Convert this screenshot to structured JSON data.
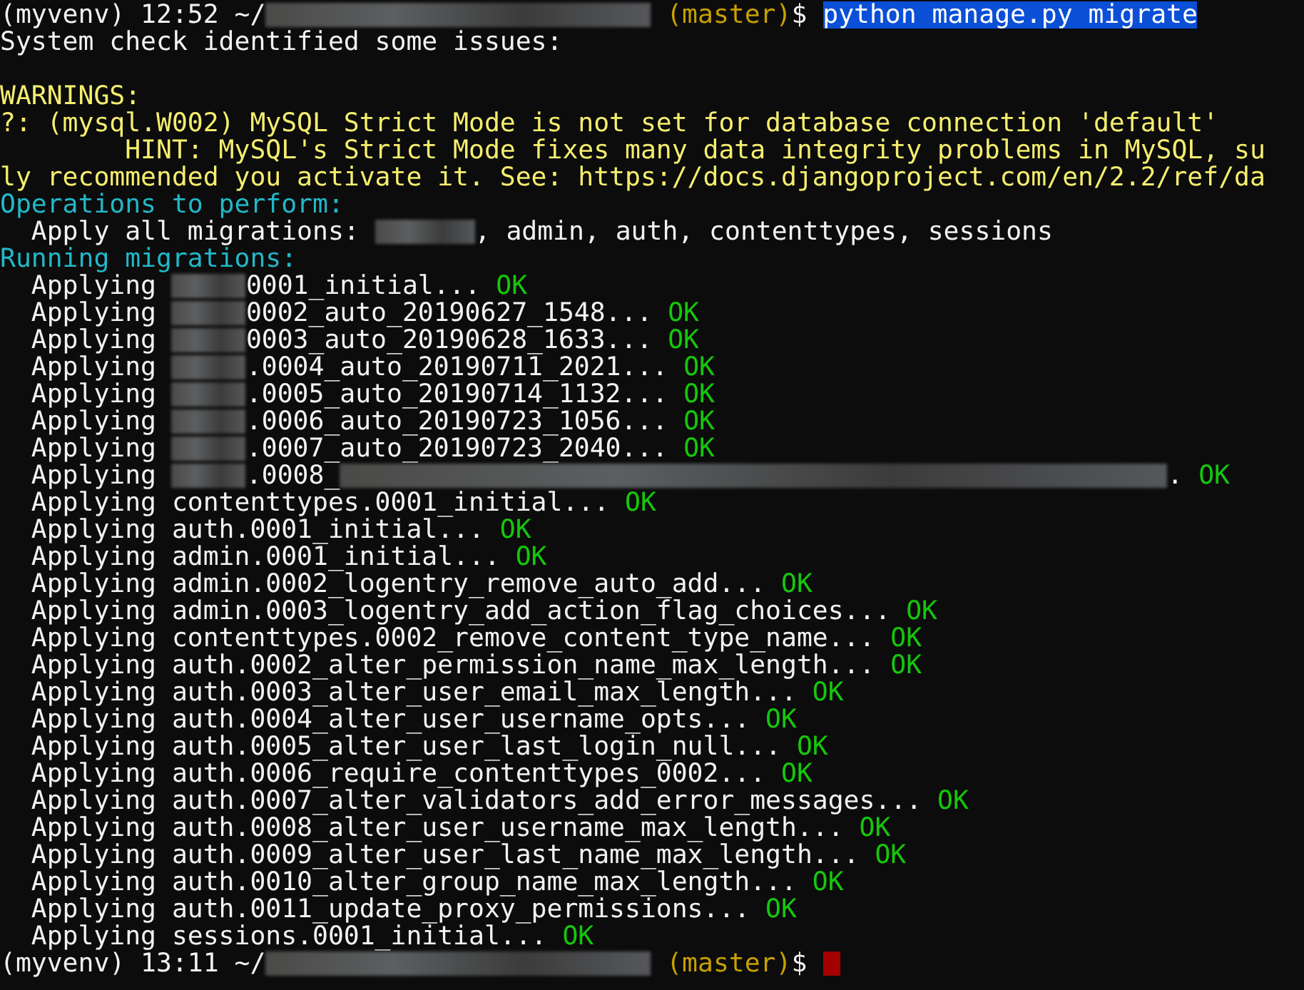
{
  "terminal": {
    "lines": [
      {
        "kind": "text",
        "segments": [
          {
            "kind": "plain",
            "text": "(myvenv) 12:52 ~/"
          },
          {
            "kind": "redacted_long"
          },
          {
            "kind": "branch",
            "text": " (master)"
          },
          {
            "kind": "plain",
            "text": "$ "
          },
          {
            "kind": "selected",
            "text": "python manage.py migrate"
          }
        ]
      },
      {
        "kind": "text",
        "segments": [
          {
            "kind": "plain",
            "text": "System check identified some issues:"
          }
        ]
      },
      {
        "kind": "blank"
      },
      {
        "kind": "text",
        "segments": [
          {
            "kind": "warn",
            "text": "WARNINGS:"
          }
        ]
      },
      {
        "kind": "text",
        "segments": [
          {
            "kind": "warn",
            "text": "?: (mysql.W002) MySQL Strict Mode is not set for database connection 'default'"
          }
        ]
      },
      {
        "kind": "text",
        "segments": [
          {
            "kind": "warn",
            "text": "        HINT: MySQL's Strict Mode fixes many data integrity problems in MySQL, su"
          }
        ]
      },
      {
        "kind": "text",
        "segments": [
          {
            "kind": "warn",
            "text": "ly recommended you activate it. See: https://docs.djangoproject.com/en/2.2/ref/da"
          }
        ]
      },
      {
        "kind": "text",
        "segments": [
          {
            "kind": "heading",
            "text": "Operations to perform:"
          }
        ]
      },
      {
        "kind": "text",
        "segments": [
          {
            "kind": "plain",
            "text": "  Apply all migrations: "
          },
          {
            "kind": "redacted_wide"
          },
          {
            "kind": "plain",
            "text": ", admin, auth, contenttypes, sessions"
          }
        ]
      },
      {
        "kind": "text",
        "segments": [
          {
            "kind": "heading",
            "text": "Running migrations:"
          }
        ]
      },
      {
        "kind": "text",
        "segments": [
          {
            "kind": "plain",
            "text": "  Applying "
          },
          {
            "kind": "redacted"
          },
          {
            "kind": "plain",
            "text": "0001_initial... "
          },
          {
            "kind": "ok",
            "text": "OK"
          }
        ]
      },
      {
        "kind": "text",
        "segments": [
          {
            "kind": "plain",
            "text": "  Applying "
          },
          {
            "kind": "redacted"
          },
          {
            "kind": "plain",
            "text": "0002_auto_20190627_1548... "
          },
          {
            "kind": "ok",
            "text": "OK"
          }
        ]
      },
      {
        "kind": "text",
        "segments": [
          {
            "kind": "plain",
            "text": "  Applying "
          },
          {
            "kind": "redacted"
          },
          {
            "kind": "plain",
            "text": "0003_auto_20190628_1633... "
          },
          {
            "kind": "ok",
            "text": "OK"
          }
        ]
      },
      {
        "kind": "text",
        "segments": [
          {
            "kind": "plain",
            "text": "  Applying "
          },
          {
            "kind": "redacted"
          },
          {
            "kind": "plain",
            "text": ".0004_auto_20190711_2021... "
          },
          {
            "kind": "ok",
            "text": "OK"
          }
        ]
      },
      {
        "kind": "text",
        "segments": [
          {
            "kind": "plain",
            "text": "  Applying "
          },
          {
            "kind": "redacted"
          },
          {
            "kind": "plain",
            "text": ".0005_auto_20190714_1132... "
          },
          {
            "kind": "ok",
            "text": "OK"
          }
        ]
      },
      {
        "kind": "text",
        "segments": [
          {
            "kind": "plain",
            "text": "  Applying "
          },
          {
            "kind": "redacted"
          },
          {
            "kind": "plain",
            "text": ".0006_auto_20190723_1056... "
          },
          {
            "kind": "ok",
            "text": "OK"
          }
        ]
      },
      {
        "kind": "text",
        "segments": [
          {
            "kind": "plain",
            "text": "  Applying "
          },
          {
            "kind": "redacted"
          },
          {
            "kind": "plain",
            "text": ".0007_auto_20190723_2040... "
          },
          {
            "kind": "ok",
            "text": "OK"
          }
        ]
      },
      {
        "kind": "text",
        "segments": [
          {
            "kind": "plain",
            "text": "  Applying "
          },
          {
            "kind": "redacted"
          },
          {
            "kind": "plain",
            "text": ".0008_"
          },
          {
            "kind": "redacted_xl"
          },
          {
            "kind": "plain",
            "text": ". "
          },
          {
            "kind": "ok",
            "text": "OK"
          }
        ]
      },
      {
        "kind": "text",
        "segments": [
          {
            "kind": "plain",
            "text": "  Applying contenttypes.0001_initial... "
          },
          {
            "kind": "ok",
            "text": "OK"
          }
        ]
      },
      {
        "kind": "text",
        "segments": [
          {
            "kind": "plain",
            "text": "  Applying auth.0001_initial... "
          },
          {
            "kind": "ok",
            "text": "OK"
          }
        ]
      },
      {
        "kind": "text",
        "segments": [
          {
            "kind": "plain",
            "text": "  Applying admin.0001_initial... "
          },
          {
            "kind": "ok",
            "text": "OK"
          }
        ]
      },
      {
        "kind": "text",
        "segments": [
          {
            "kind": "plain",
            "text": "  Applying admin.0002_logentry_remove_auto_add... "
          },
          {
            "kind": "ok",
            "text": "OK"
          }
        ]
      },
      {
        "kind": "text",
        "segments": [
          {
            "kind": "plain",
            "text": "  Applying admin.0003_logentry_add_action_flag_choices... "
          },
          {
            "kind": "ok",
            "text": "OK"
          }
        ]
      },
      {
        "kind": "text",
        "segments": [
          {
            "kind": "plain",
            "text": "  Applying contenttypes.0002_remove_content_type_name... "
          },
          {
            "kind": "ok",
            "text": "OK"
          }
        ]
      },
      {
        "kind": "text",
        "segments": [
          {
            "kind": "plain",
            "text": "  Applying auth.0002_alter_permission_name_max_length... "
          },
          {
            "kind": "ok",
            "text": "OK"
          }
        ]
      },
      {
        "kind": "text",
        "segments": [
          {
            "kind": "plain",
            "text": "  Applying auth.0003_alter_user_email_max_length... "
          },
          {
            "kind": "ok",
            "text": "OK"
          }
        ]
      },
      {
        "kind": "text",
        "segments": [
          {
            "kind": "plain",
            "text": "  Applying auth.0004_alter_user_username_opts... "
          },
          {
            "kind": "ok",
            "text": "OK"
          }
        ]
      },
      {
        "kind": "text",
        "segments": [
          {
            "kind": "plain",
            "text": "  Applying auth.0005_alter_user_last_login_null... "
          },
          {
            "kind": "ok",
            "text": "OK"
          }
        ]
      },
      {
        "kind": "text",
        "segments": [
          {
            "kind": "plain",
            "text": "  Applying auth.0006_require_contenttypes_0002... "
          },
          {
            "kind": "ok",
            "text": "OK"
          }
        ]
      },
      {
        "kind": "text",
        "segments": [
          {
            "kind": "plain",
            "text": "  Applying auth.0007_alter_validators_add_error_messages... "
          },
          {
            "kind": "ok",
            "text": "OK"
          }
        ]
      },
      {
        "kind": "text",
        "segments": [
          {
            "kind": "plain",
            "text": "  Applying auth.0008_alter_user_username_max_length... "
          },
          {
            "kind": "ok",
            "text": "OK"
          }
        ]
      },
      {
        "kind": "text",
        "segments": [
          {
            "kind": "plain",
            "text": "  Applying auth.0009_alter_user_last_name_max_length... "
          },
          {
            "kind": "ok",
            "text": "OK"
          }
        ]
      },
      {
        "kind": "text",
        "segments": [
          {
            "kind": "plain",
            "text": "  Applying auth.0010_alter_group_name_max_length... "
          },
          {
            "kind": "ok",
            "text": "OK"
          }
        ]
      },
      {
        "kind": "text",
        "segments": [
          {
            "kind": "plain",
            "text": "  Applying auth.0011_update_proxy_permissions... "
          },
          {
            "kind": "ok",
            "text": "OK"
          }
        ]
      },
      {
        "kind": "text",
        "segments": [
          {
            "kind": "plain",
            "text": "  Applying sessions.0001_initial... "
          },
          {
            "kind": "ok",
            "text": "OK"
          }
        ]
      },
      {
        "kind": "text",
        "segments": [
          {
            "kind": "plain",
            "text": "(myvenv) 13:11 ~/"
          },
          {
            "kind": "redacted_long"
          },
          {
            "kind": "branch",
            "text": " (master)"
          },
          {
            "kind": "plain",
            "text": "$ "
          },
          {
            "kind": "cursor"
          }
        ]
      }
    ]
  }
}
